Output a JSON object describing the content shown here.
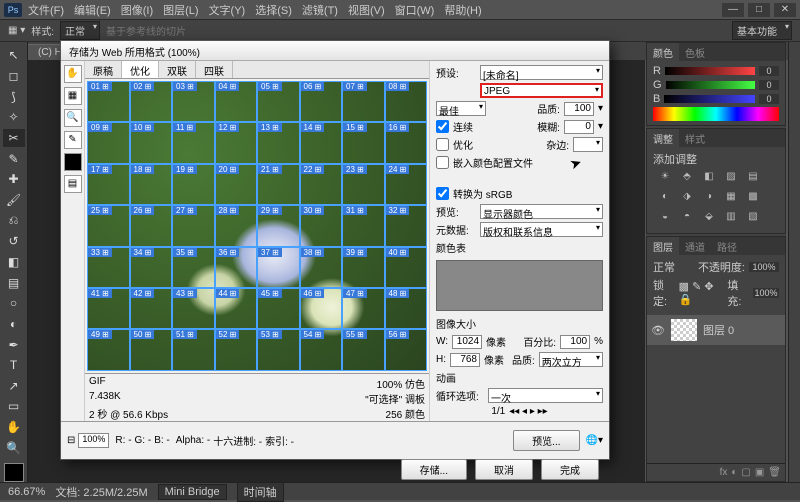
{
  "menu": {
    "items": [
      "文件(F)",
      "编辑(E)",
      "图像(I)",
      "图层(L)",
      "文字(Y)",
      "选择(S)",
      "滤镜(T)",
      "视图(V)",
      "窗口(W)",
      "帮助(H)"
    ],
    "logo": "Ps"
  },
  "optbar": {
    "style_lbl": "样式:",
    "style_val": "正常",
    "based": "基于参考线的切片",
    "essentials": "基本功能"
  },
  "doc_tab": "(C) Hydrange...",
  "status": {
    "zoom": "66.67%",
    "doc": "文档: 2.25M/2.25M",
    "mb": "Mini Bridge",
    "tl": "时间轴"
  },
  "panels": {
    "color": {
      "tabs": [
        "颜色",
        "色板"
      ],
      "r": "R",
      "g": "G",
      "b": "B",
      "val": "0"
    },
    "adjust": {
      "tabs": [
        "调整",
        "样式"
      ],
      "title": "添加调整"
    },
    "layers": {
      "tabs": [
        "图层",
        "通道",
        "路径"
      ],
      "mode_lbl": "正常",
      "opacity_lbl": "不透明度:",
      "opacity": "100%",
      "lock_lbl": "锁定:",
      "fill_lbl": "填充:",
      "fill": "100%",
      "layer0": "图层 0"
    }
  },
  "dialog": {
    "title": "存储为 Web 所用格式 (100%)",
    "tabs": [
      "原稿",
      "优化",
      "双联",
      "四联"
    ],
    "info": {
      "fmt": "GIF",
      "size": "7.438K",
      "time": "2 秒 @ 56.6 Kbps",
      "dither": "100% 仿色",
      "pal": "\"可选择\" 调板",
      "colors": "256 颜色"
    },
    "right": {
      "preset_lbl": "预设:",
      "preset_val": "[未命名]",
      "format_val": "JPEG",
      "opt_lbl": "最佳",
      "qual_lbl": "品质:",
      "qual": "100",
      "prog_lbl": "连续",
      "blur_lbl": "模糊:",
      "blur": "0",
      "optck": "优化",
      "matte_lbl": "杂边:",
      "icc": "嵌入颜色配置文件",
      "srgb": "转换为 sRGB",
      "preview_lbl": "预览:",
      "preview_val": "显示器颜色",
      "meta_lbl": "元数据:",
      "meta_val": "版权和联系信息",
      "ct_lbl": "颜色表",
      "size_lbl": "图像大小",
      "w": "1024",
      "h": "768",
      "px": "像素",
      "pct_lbl": "百分比:",
      "pct": "100",
      "q2_lbl": "品质:",
      "q2_val": "两次立方",
      "anim_lbl": "动画",
      "loop_lbl": "循环选项:",
      "loop_val": "一次",
      "frame": "1/1"
    },
    "bottom": {
      "zoom": "100%",
      "r": "R: -",
      "g": "G: -",
      "b": "B: -",
      "alpha": "Alpha: -",
      "hex": "十六进制: -",
      "idx": "索引: -"
    },
    "buttons": {
      "preview": "预览...",
      "save": "存储...",
      "cancel": "取消",
      "done": "完成"
    }
  }
}
